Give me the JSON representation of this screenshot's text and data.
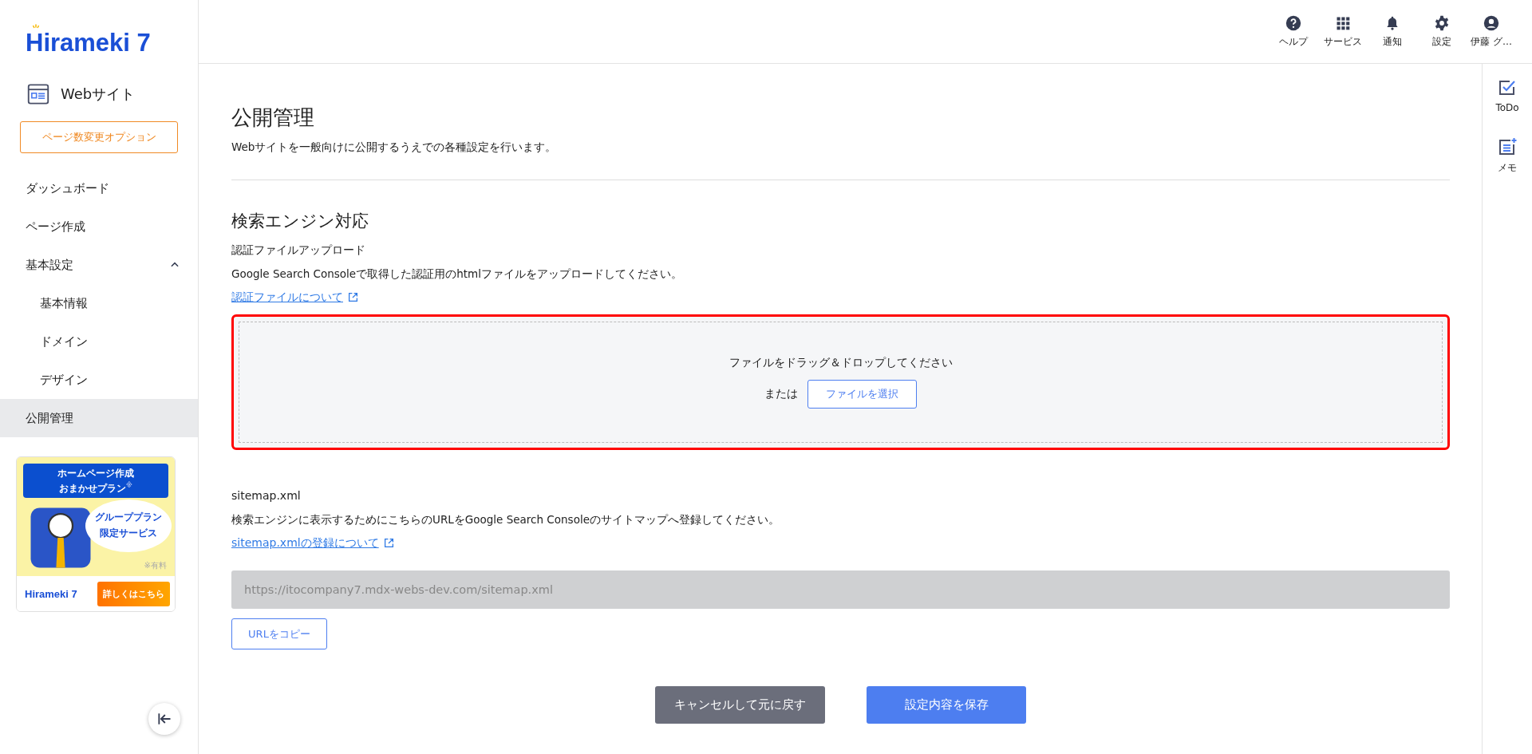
{
  "sidebar": {
    "logo": "Hirameki 7",
    "product": "Webサイト",
    "option_button": "ページ数変更オプション",
    "items": [
      {
        "label": "ダッシュボード",
        "selected": false
      },
      {
        "label": "ページ作成",
        "selected": false
      },
      {
        "label": "基本設定",
        "selected": false,
        "expanded": true,
        "children": [
          {
            "label": "基本情報",
            "selected": false
          },
          {
            "label": "ドメイン",
            "selected": false
          },
          {
            "label": "デザイン",
            "selected": false
          }
        ]
      },
      {
        "label": "公開管理",
        "selected": true
      }
    ],
    "banner": {
      "title_lines": [
        "ホームページ作成",
        "おまかせプラン"
      ],
      "title_mark": "※",
      "bubble_lines": [
        "グループプラン",
        "限定サービス"
      ],
      "note": "※有料",
      "logo": "Hirameki 7",
      "button": "詳しくはこちら"
    }
  },
  "header": {
    "actions": [
      {
        "kind": "help",
        "label": "ヘルプ"
      },
      {
        "kind": "services",
        "label": "サービス"
      },
      {
        "kind": "notifications",
        "label": "通知"
      },
      {
        "kind": "settings",
        "label": "設定"
      },
      {
        "kind": "user",
        "label": "伊藤 グ…"
      }
    ]
  },
  "right_rail": [
    {
      "kind": "todo",
      "label": "ToDo"
    },
    {
      "kind": "memo",
      "label": "メモ"
    }
  ],
  "page": {
    "title": "公開管理",
    "subtitle": "Webサイトを一般向けに公開するうえでの各種設定を行います。",
    "section_title": "検索エンジン対応",
    "upload": {
      "label": "認証ファイルアップロード",
      "description": "Google Search Consoleで取得した認証用のhtmlファイルをアップロードしてください。",
      "link": "認証ファイルについて",
      "drop_text": "ファイルをドラッグ＆ドロップしてください",
      "or_text": "または",
      "select_button": "ファイルを選択",
      "highlighted": true
    },
    "sitemap": {
      "label": "sitemap.xml",
      "description": "検索エンジンに表示するためにこちらのURLをGoogle Search Consoleのサイトマップへ登録してください。",
      "link": "sitemap.xmlの登録について",
      "url": "https://itocompany7.mdx-webs-dev.com/sitemap.xml",
      "copy_button": "URLをコピー"
    },
    "cancel_button": "キャンセルして元に戻す",
    "save_button": "設定内容を保存"
  }
}
